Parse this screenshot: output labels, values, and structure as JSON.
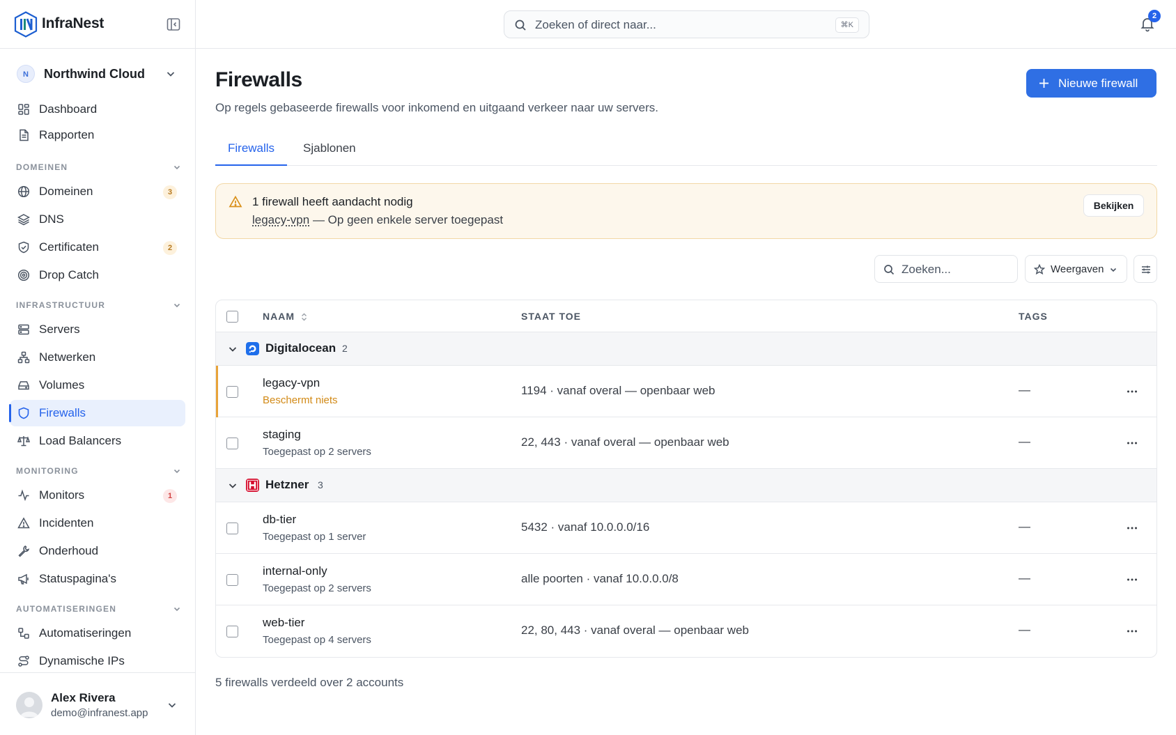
{
  "app": {
    "name": "InfraNest"
  },
  "org": {
    "initial": "N",
    "name": "Northwind Cloud"
  },
  "sidebar": {
    "top_items": [
      {
        "label": "Dashboard",
        "icon": "dashboard-icon"
      },
      {
        "label": "Rapporten",
        "icon": "document-icon"
      }
    ],
    "sections": {
      "domeinen": {
        "title": "DOMEINEN",
        "items": [
          {
            "label": "Domeinen",
            "icon": "globe-icon",
            "badge": "3"
          },
          {
            "label": "DNS",
            "icon": "layers-icon"
          },
          {
            "label": "Certificaten",
            "icon": "shield-check-icon",
            "badge": "2"
          },
          {
            "label": "Drop Catch",
            "icon": "target-icon"
          }
        ]
      },
      "infra": {
        "title": "INFRASTRUCTUUR",
        "items": [
          {
            "label": "Servers",
            "icon": "server-icon"
          },
          {
            "label": "Netwerken",
            "icon": "network-icon"
          },
          {
            "label": "Volumes",
            "icon": "hard-drive-icon"
          },
          {
            "label": "Firewalls",
            "icon": "shield-icon",
            "active": true
          },
          {
            "label": "Load Balancers",
            "icon": "scale-icon"
          }
        ]
      },
      "monitoring": {
        "title": "MONITORING",
        "items": [
          {
            "label": "Monitors",
            "icon": "activity-icon",
            "badge": "1"
          },
          {
            "label": "Incidenten",
            "icon": "alert-triangle-icon"
          },
          {
            "label": "Onderhoud",
            "icon": "wrench-icon"
          },
          {
            "label": "Statuspagina's",
            "icon": "megaphone-icon"
          }
        ]
      },
      "auto": {
        "title": "AUTOMATISERINGEN",
        "items": [
          {
            "label": "Automatiseringen",
            "icon": "workflow-icon"
          },
          {
            "label": "Dynamische IPs",
            "icon": "route-icon"
          }
        ]
      }
    }
  },
  "user": {
    "name": "Alex Rivera",
    "email": "demo@infranest.app"
  },
  "topbar": {
    "search_placeholder": "Zoeken of direct naar...",
    "shortcut": "⌘K",
    "notifications": "2"
  },
  "page": {
    "title": "Firewalls",
    "subtitle": "Op regels gebaseerde firewalls voor inkomend en uitgaand verkeer naar uw servers.",
    "primary_button": "Nieuwe firewall",
    "tabs": [
      "Firewalls",
      "Sjablonen"
    ]
  },
  "alert": {
    "title": "1 firewall heeft aandacht nodig",
    "link": "legacy-vpn",
    "detail": " — Op geen enkele server toegepast",
    "button": "Bekijken"
  },
  "toolbar": {
    "search_placeholder": "Zoeken...",
    "views_label": "Weergaven"
  },
  "table": {
    "headers": {
      "name": "NAAM",
      "allows": "STAAT TOE",
      "tags": "TAGS"
    },
    "groups": [
      {
        "name": "Digitalocean",
        "count": "2",
        "color": "#1f6feb",
        "rows": [
          {
            "name": "legacy-vpn",
            "sub": "Beschermt niets",
            "rule": "1194 · vanaf overal — openbaar web",
            "tags": "—",
            "warning": true
          },
          {
            "name": "staging",
            "sub": "Toegepast op 2 servers",
            "rule": "22, 443 · vanaf overal — openbaar web",
            "tags": "—"
          }
        ]
      },
      {
        "name": "Hetzner",
        "count": "3",
        "color": "#d50c2d",
        "rows": [
          {
            "name": "db-tier",
            "sub": "Toegepast op 1 server",
            "rule": "5432 · vanaf 10.0.0.0/16",
            "tags": "—"
          },
          {
            "name": "internal-only",
            "sub": "Toegepast op 2 servers",
            "rule": "alle poorten · vanaf 10.0.0.0/8",
            "tags": "—"
          },
          {
            "name": "web-tier",
            "sub": "Toegepast op 4 servers",
            "rule": "22, 80, 443 · vanaf overal — openbaar web",
            "tags": "—"
          }
        ]
      }
    ]
  },
  "footer": {
    "summary": "5 firewalls verdeeld over 2 accounts"
  },
  "colors": {
    "accent": "#2563eb",
    "warning": "#e8a33a",
    "border": "#e6e8ec"
  }
}
